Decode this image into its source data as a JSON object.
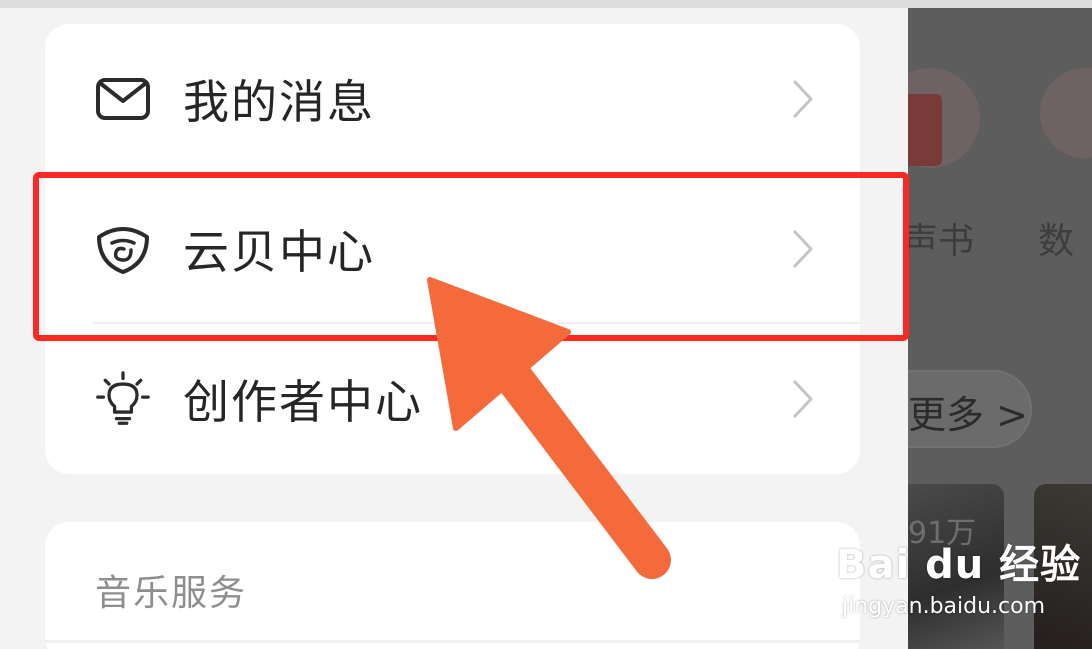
{
  "menu": {
    "items": [
      {
        "label": "我的消息",
        "icon": "envelope-icon"
      },
      {
        "label": "云贝中心",
        "icon": "cloud-coin-icon"
      },
      {
        "label": "创作者中心",
        "icon": "lightbulb-icon"
      }
    ],
    "chevron_icon": "chevron-right-icon"
  },
  "music_section": {
    "title": "音乐服务"
  },
  "background_page": {
    "label_1": "声书",
    "label_2": "数",
    "more_button": "更多 >",
    "play_count": "91万"
  },
  "annotation": {
    "highlight_color": "#fa2a23",
    "arrow_color": "#f46a3b"
  },
  "watermark": {
    "logo_text": "Bai du 经验",
    "url": "jingyan.baidu.com"
  }
}
